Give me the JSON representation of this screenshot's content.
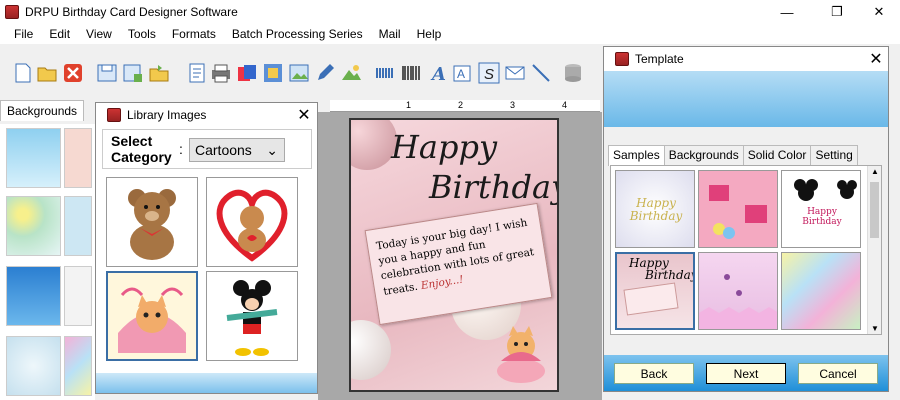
{
  "app": {
    "title": "DRPU Birthday Card Designer Software"
  },
  "menu": [
    "File",
    "Edit",
    "View",
    "Tools",
    "Formats",
    "Batch Processing Series",
    "Mail",
    "Help"
  ],
  "toolbar": {
    "icons": [
      "new-icon",
      "open-icon",
      "close-icon",
      "save-icon",
      "save-as-icon",
      "open-folder-icon",
      "properties-icon",
      "print-icon",
      "copy-icon",
      "export-icon",
      "image-icon",
      "pen-icon",
      "picture-icon",
      "watermark-icon",
      "barcode-icon",
      "text-icon",
      "text-box-icon",
      "signature-icon",
      "mail-icon",
      "line-icon",
      "database-icon"
    ]
  },
  "ruler": {
    "ticks": [
      "1",
      "2",
      "3",
      "4"
    ]
  },
  "backgrounds_panel": {
    "tab_label": "Backgrounds"
  },
  "library": {
    "title": "Library Images",
    "category_label_line1": "Select",
    "category_label_line2": "Category",
    "category_value": "Cartoons"
  },
  "card": {
    "line1": "Happy",
    "line2": "Birthday",
    "message": "Today is your big day! I wish you a happy and fun celebration with lots of great treats.",
    "signoff": "Enjoy...!"
  },
  "template": {
    "title": "Template",
    "tabs": [
      "Samples",
      "Backgrounds",
      "Solid Color",
      "Setting"
    ],
    "thumb1_text": "Happy Birthday",
    "thumb3_text": "Happy Birthday",
    "thumb4_line1": "Happy",
    "thumb4_line2": "Birthday",
    "buttons": {
      "back": "Back",
      "next": "Next",
      "cancel": "Cancel"
    }
  },
  "colors": {
    "accent_blue": "#1f8fd8",
    "card_pink": "#e8b8c0",
    "footer_light": "#7dc3ee"
  }
}
